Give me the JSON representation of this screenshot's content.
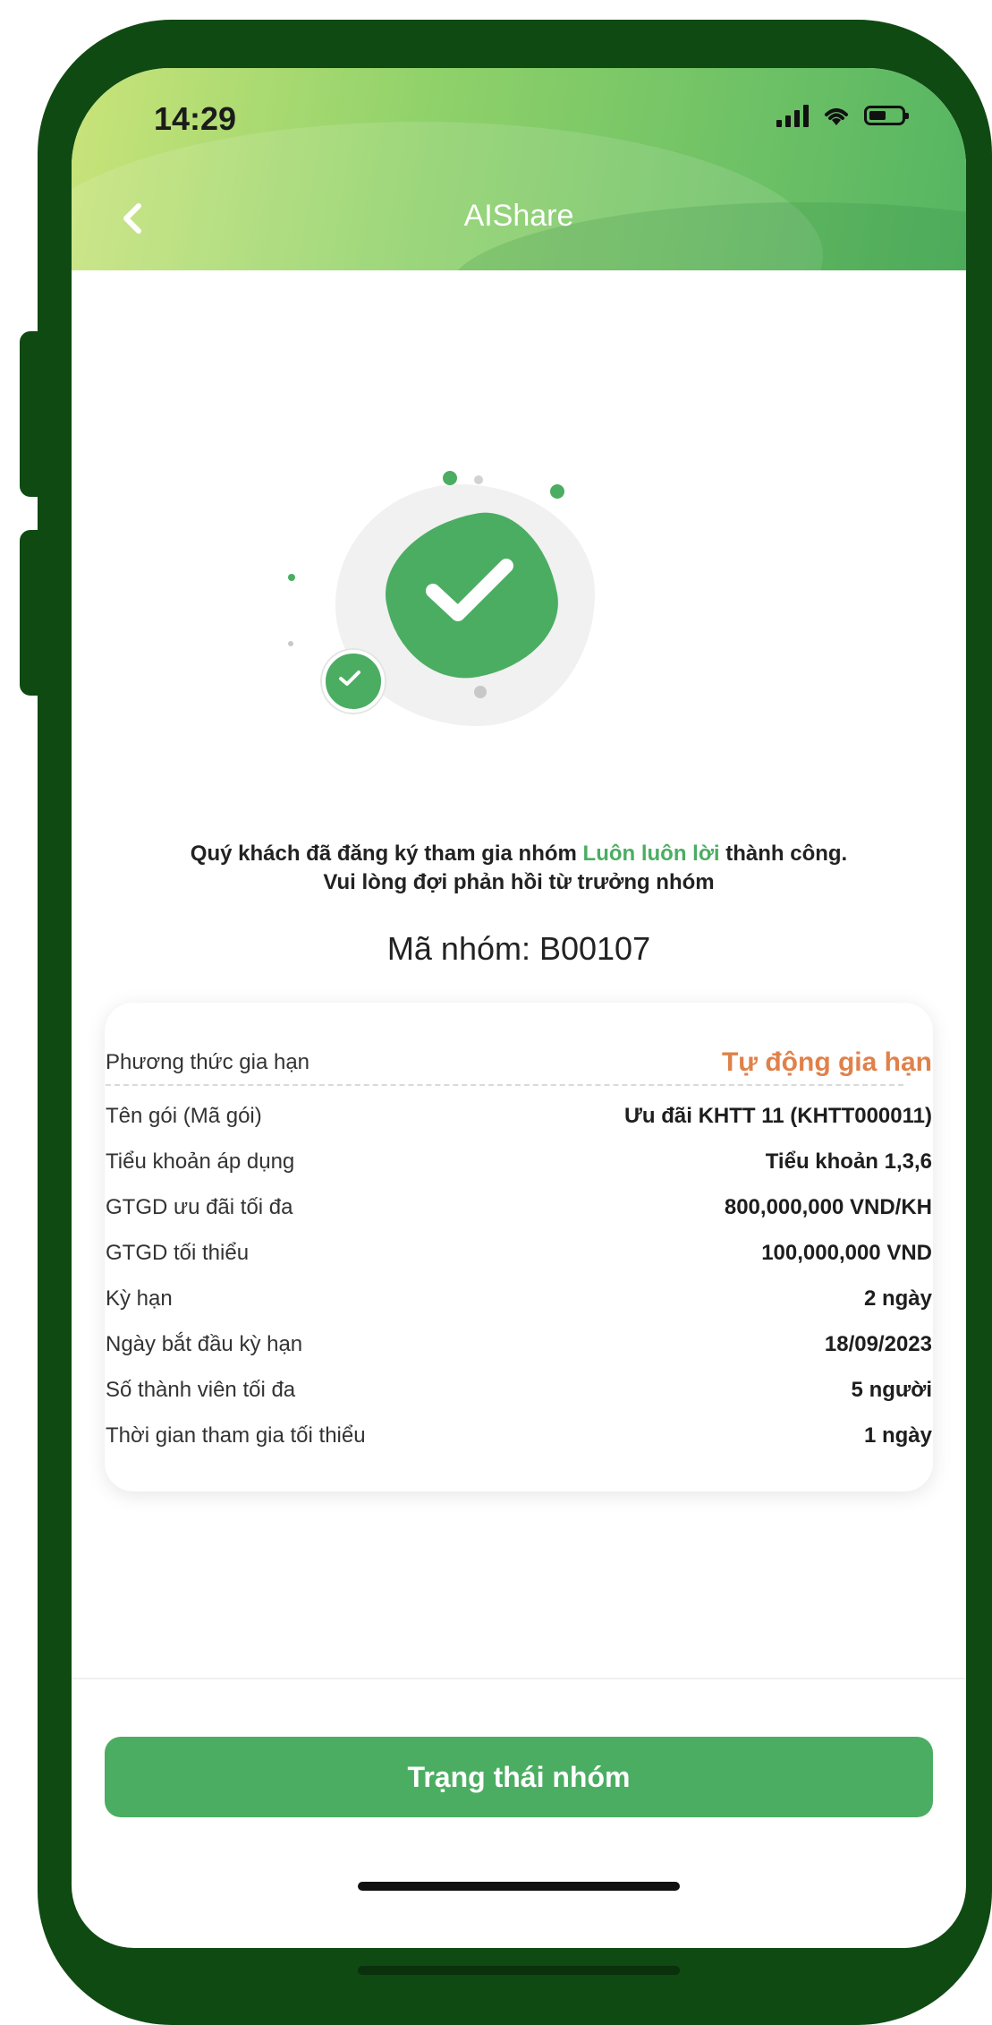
{
  "status_bar": {
    "time": "14:29"
  },
  "header": {
    "title": "AIShare",
    "back_icon": "chevron-left-icon"
  },
  "message": {
    "line1_prefix": "Quý khách đã đăng ký tham gia nhóm ",
    "group_name": "Luôn luôn lời",
    "line1_suffix": " thành công.",
    "line2": "Vui lòng đợi phản hồi từ trưởng nhóm"
  },
  "group_code": "Mã nhóm: B00107",
  "details": {
    "renewal_label": "Phương thức gia hạn",
    "renewal_value": "Tự động gia hạn",
    "rows": [
      {
        "label": "Tên gói (Mã gói)",
        "value": "Ưu đãi KHTT 11 (KHTT000011)"
      },
      {
        "label": "Tiểu khoản áp dụng",
        "value": "Tiểu khoản 1,3,6"
      },
      {
        "label": "GTGD ưu đãi tối đa",
        "value": "800,000,000 VND/KH"
      },
      {
        "label": "GTGD tối thiểu",
        "value": "100,000,000 VND"
      },
      {
        "label": "Kỳ hạn",
        "value": "2 ngày"
      },
      {
        "label": "Ngày bắt đầu kỳ hạn",
        "value": "18/09/2023"
      },
      {
        "label": "Số thành viên tối đa",
        "value": "5 người"
      },
      {
        "label": "Thời gian tham gia tối thiểu",
        "value": "1 ngày"
      }
    ]
  },
  "primary_button": {
    "label": "Trạng thái nhóm"
  },
  "colors": {
    "brand_green": "#4bad62",
    "accent_orange": "#e0814a",
    "frame_green": "#0f4a12"
  }
}
